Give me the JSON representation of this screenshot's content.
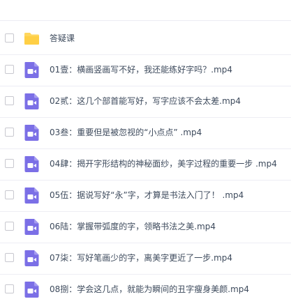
{
  "file_list": {
    "items": [
      {
        "type": "folder",
        "icon": "folder-icon",
        "name": "答疑课",
        "ext": ""
      },
      {
        "type": "video",
        "icon": "video-icon",
        "name": "01壹：横画竖画写不好，我还能练好字吗？",
        "ext": ".mp4"
      },
      {
        "type": "video",
        "icon": "video-icon",
        "name": "02贰：这几个部首能写好，写字应该不会太差",
        "ext": ".mp4"
      },
      {
        "type": "video",
        "icon": "video-icon",
        "name": "03叁：重要但是被忽视的“小点点” ",
        "ext": ".mp4"
      },
      {
        "type": "video",
        "icon": "video-icon",
        "name": "04肆：揭开字形结构的神秘面纱，美字过程的重要一步 ",
        "ext": ".mp4"
      },
      {
        "type": "video",
        "icon": "video-icon",
        "name": "05伍：据说写好“永”字，才算是书法入门了！ ",
        "ext": ".mp4"
      },
      {
        "type": "video",
        "icon": "video-icon",
        "name": "06陆：掌握带弧度的字，领略书法之美",
        "ext": ".mp4"
      },
      {
        "type": "video",
        "icon": "video-icon",
        "name": "07柒：写好笔画少的字，离美字更近了一步",
        "ext": ".mp4"
      },
      {
        "type": "video",
        "icon": "video-icon",
        "name": "08捌：学会这几点，就能为瞬间的丑字瘦身美颜",
        "ext": ".mp4"
      }
    ]
  },
  "colors": {
    "folder": "#ffd75e",
    "video": "#7b6fe6",
    "text": "#3d4a5c",
    "divider": "#ededf4"
  }
}
